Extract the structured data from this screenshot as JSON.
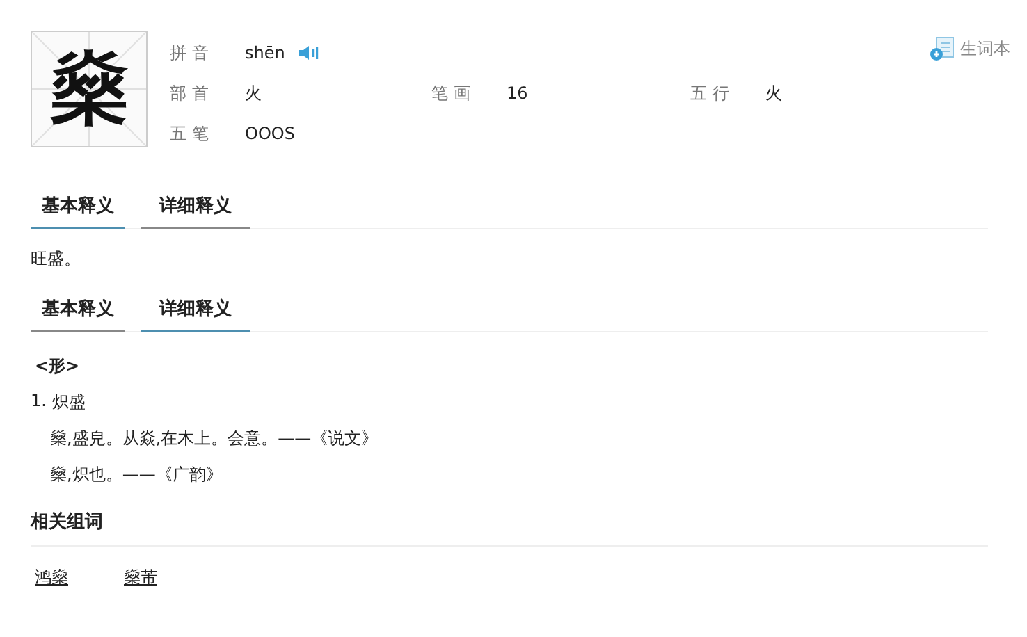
{
  "character": "燊",
  "info": [
    {
      "cells": [
        {
          "label": "拼音",
          "value": "shēn",
          "kind": "pinyin"
        }
      ]
    },
    {
      "cells": [
        {
          "label": "部首",
          "value": "火",
          "kind": "plain"
        },
        {
          "label": "笔画",
          "value": "16",
          "kind": "plain"
        },
        {
          "label": "五行",
          "value": "火",
          "kind": "plain"
        }
      ]
    },
    {
      "cells": [
        {
          "label": "五笔",
          "value": "OOOS",
          "kind": "plain"
        }
      ]
    }
  ],
  "wordbook": {
    "label": "生词本"
  },
  "basic": {
    "tabs": [
      {
        "label": "基本释义",
        "selected": true
      },
      {
        "label": "详细释义",
        "selected": false
      }
    ],
    "text": "旺盛。"
  },
  "detail": {
    "tabs": [
      {
        "label": "基本释义",
        "selected": false
      },
      {
        "label": "详细释义",
        "selected": true
      }
    ],
    "part_of_speech": "<形>",
    "senses": [
      {
        "number": "1.",
        "meaning": "炽盛",
        "quotes": [
          "燊,盛皃。从焱,在木上。会意。——《说文》",
          "燊,炽也。——《广韵》"
        ]
      }
    ]
  },
  "related": {
    "title": "相关组词",
    "words": [
      "鸿燊",
      "燊芾"
    ]
  }
}
